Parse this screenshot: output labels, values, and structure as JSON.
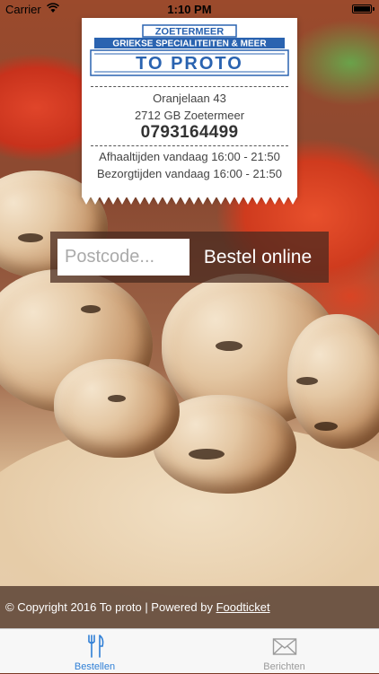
{
  "status_bar": {
    "carrier": "Carrier",
    "time": "1:10 PM"
  },
  "logo": {
    "top_text": "ZOETERMEER",
    "tagline": "GRIEKSE SPECIALITEITEN & MEER",
    "name": "TO PROTO"
  },
  "restaurant": {
    "address_line1": "Oranjelaan 43",
    "address_line2": "2712 GB Zoetermeer",
    "phone": "0793164499",
    "pickup_times": "Afhaaltijden vandaag 16:00 - 21:50",
    "delivery_times": "Bezorgtijden vandaag 16:00 - 21:50"
  },
  "order": {
    "postcode_placeholder": "Postcode...",
    "postcode_value": "",
    "button_label": "Bestel online"
  },
  "footer": {
    "copyright": "© Copyright 2016 To proto | Powered by ",
    "link_text": "Foodticket"
  },
  "tabs": [
    {
      "label": "Bestellen",
      "icon": "fork-knife-icon",
      "active": true
    },
    {
      "label": "Berichten",
      "icon": "envelope-icon",
      "active": false
    }
  ],
  "colors": {
    "accent": "#2f7fd6",
    "logo_blue": "#2a63b0",
    "inactive_tab": "#9a9a9a"
  }
}
